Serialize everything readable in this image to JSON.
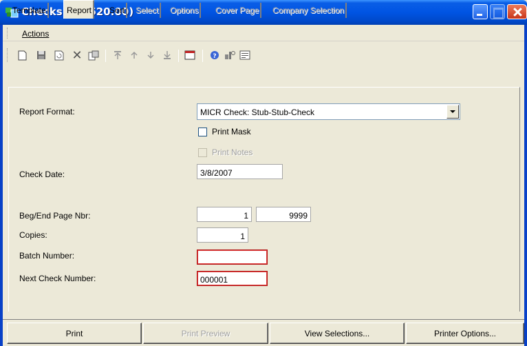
{
  "window": {
    "title": "Checks (03.620.00)"
  },
  "menu": {
    "actions_label": "Actions"
  },
  "toolbar": {
    "icons": [
      "new-icon",
      "save-icon",
      "refresh-icon",
      "delete-icon",
      "copy-icon",
      "first-icon",
      "previous-icon",
      "next-icon",
      "last-icon",
      "window-icon",
      "help-icon",
      "customize-icon",
      "notes-icon"
    ]
  },
  "tabs": [
    {
      "label": "Template",
      "state": "normal"
    },
    {
      "label": "Report",
      "state": "active"
    },
    {
      "label": "Sort",
      "state": "normal"
    },
    {
      "label": "Select",
      "state": "disabled"
    },
    {
      "label": "Options",
      "state": "disabled"
    },
    {
      "label": "Cover Page",
      "state": "disabled"
    },
    {
      "label": "Company Selection",
      "state": "disabled"
    }
  ],
  "form": {
    "report_format_label": "Report Format:",
    "report_format_value": "MICR Check: Stub-Stub-Check",
    "print_mask_label": "Print Mask",
    "print_mask_checked": false,
    "print_notes_label": "Print Notes",
    "print_notes_checked": false,
    "check_date_label": "Check Date:",
    "check_date_value": "3/8/2007",
    "page_nbr_label": "Beg/End Page Nbr:",
    "beg_page_value": "1",
    "end_page_value": "9999",
    "copies_label": "Copies:",
    "copies_value": "1",
    "batch_number_label": "Batch Number:",
    "batch_number_value": "",
    "next_check_label": "Next Check Number:",
    "next_check_value": "000001"
  },
  "buttons": {
    "print": "Print",
    "print_preview": "Print Preview",
    "view_selections": "View Selections...",
    "printer_options": "Printer Options..."
  },
  "colors": {
    "titlebar": "#0054e3",
    "background": "#ece9d8",
    "required_border": "#b01010"
  }
}
